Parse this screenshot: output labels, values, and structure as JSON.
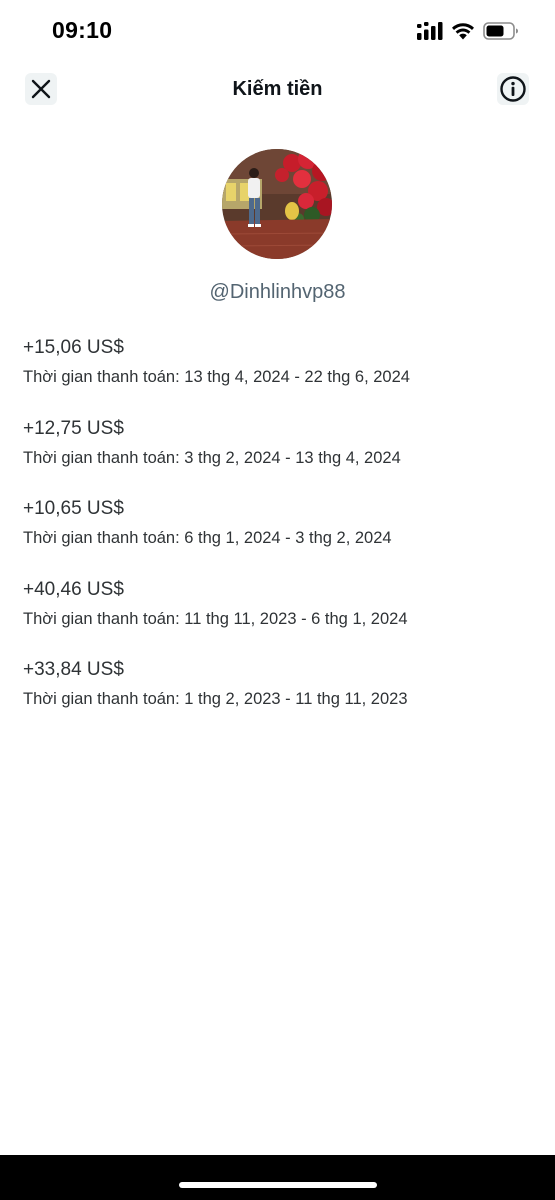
{
  "status_bar": {
    "time": "09:10",
    "icons": [
      "signal-icon",
      "wifi-icon",
      "battery-icon"
    ]
  },
  "header": {
    "title": "Kiếm tiền",
    "close_icon": "close-icon",
    "info_icon": "info-icon"
  },
  "profile": {
    "username": "@Dinhlinhvp88"
  },
  "payouts": [
    {
      "amount": "+15,06 US$",
      "period": "Thời gian thanh toán: 13 thg 4, 2024 - 22 thg 6, 2024"
    },
    {
      "amount": "+12,75 US$",
      "period": "Thời gian thanh toán: 3 thg 2, 2024 - 13 thg 4, 2024"
    },
    {
      "amount": "+10,65 US$",
      "period": "Thời gian thanh toán: 6 thg 1, 2024 - 3 thg 2, 2024"
    },
    {
      "amount": "+40,46 US$",
      "period": "Thời gian thanh toán: 11 thg 11, 2023 - 6 thg 1, 2024"
    },
    {
      "amount": "+33,84 US$",
      "period": "Thời gian thanh toán: 1 thg 2, 2023 - 11 thg 11, 2023"
    }
  ],
  "colors": {
    "text_primary": "#0f1419",
    "text_secondary": "#536471",
    "button_bg": "#eff3f4"
  }
}
